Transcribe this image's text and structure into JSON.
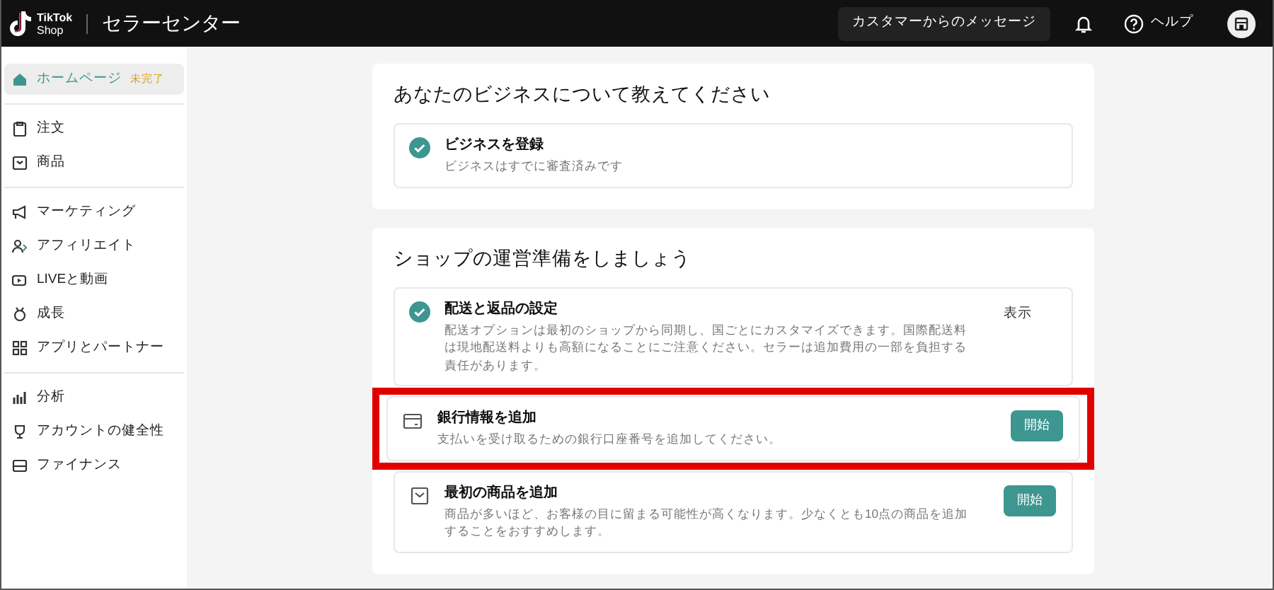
{
  "header": {
    "logo_top": "TikTok",
    "logo_bottom": "Shop",
    "title": "セラーセンター",
    "messages_button": "カスタマーからのメッセージ",
    "help": "ヘルプ"
  },
  "sidebar": {
    "groups": [
      [
        {
          "label": "ホームページ",
          "badge": "未完了",
          "selected": true
        }
      ],
      [
        {
          "label": "注文",
          "selected": false
        },
        {
          "label": "商品",
          "selected": false
        }
      ],
      [
        {
          "label": "マーケティング",
          "selected": false
        },
        {
          "label": "アフィリエイト",
          "selected": false
        },
        {
          "label": "LIVEと動画",
          "selected": false
        },
        {
          "label": "成長",
          "selected": false
        },
        {
          "label": "アプリとパートナー",
          "selected": false
        }
      ],
      [
        {
          "label": "分析",
          "selected": false
        },
        {
          "label": "アカウントの健全性",
          "selected": false
        },
        {
          "label": "ファイナンス",
          "selected": false
        }
      ]
    ]
  },
  "sections": [
    {
      "title": "あなたのビジネスについて教えてください",
      "tasks": [
        {
          "kind": "done",
          "title": "ビジネスを登録",
          "description": "ビジネスはすでに審査済みです",
          "highlighted": false
        }
      ]
    },
    {
      "title": "ショップの運営準備をしましょう",
      "tasks": [
        {
          "kind": "done",
          "title": "配送と返品の設定",
          "description": "配送オプションは最初のショップから同期し、国ごとにカスタマイズできます。国際配送料は現地配送料よりも高額になることにご注意ください。セラーは追加費用の一部を負担する責任があります。",
          "action": {
            "label": "表示",
            "primary": false
          },
          "highlighted": false
        },
        {
          "kind": "card",
          "title": "銀行情報を追加",
          "description": "支払いを受け取るための銀行口座番号を追加してください。",
          "action": {
            "label": "開始",
            "primary": true
          },
          "highlighted": true
        },
        {
          "kind": "box",
          "title": "最初の商品を追加",
          "description": "商品が多いほど、お客様の目に留まる可能性が高くなります。少なくとも10点の商品を追加することをおすすめします。",
          "action": {
            "label": "開始",
            "primary": true
          },
          "highlighted": false
        }
      ]
    }
  ]
}
